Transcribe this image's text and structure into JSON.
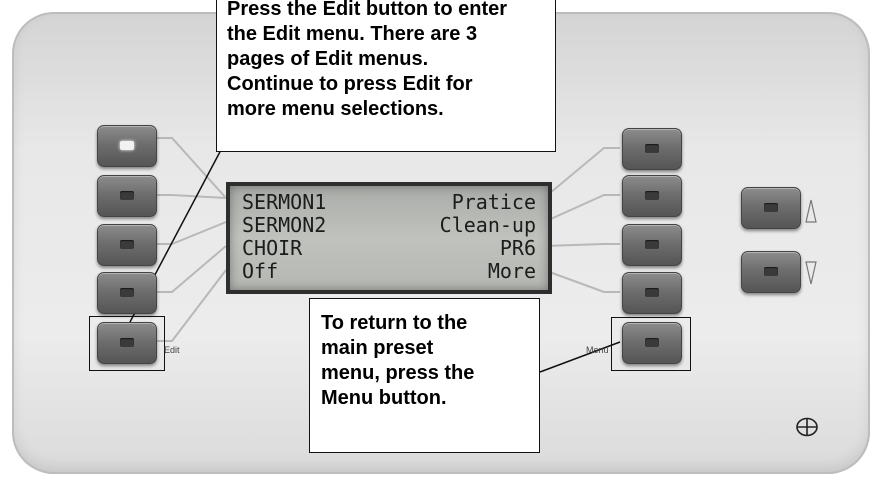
{
  "lcd": {
    "rows": [
      {
        "left": "SERMON1",
        "right": "Pratice"
      },
      {
        "left": "SERMON2",
        "right": "Clean-up"
      },
      {
        "left": "CHOIR",
        "right": "PR6"
      },
      {
        "left": "Off",
        "right": "More"
      }
    ]
  },
  "labels": {
    "edit": "Edit",
    "menu": "Menu"
  },
  "callouts": {
    "edit": [
      "Press the Edit button to enter",
      "the Edit menu. There are 3",
      "pages of Edit menus.",
      "Continue to press Edit for",
      "more menu selections."
    ],
    "menu": [
      "To return to the",
      "main preset",
      "menu, press the",
      "Menu button."
    ]
  },
  "icons": {
    "up": "up-arrow-icon",
    "down": "down-arrow-icon",
    "logo": "circle-cross-logo-icon"
  },
  "colors": {
    "panel": "#e8e8e8",
    "button": "#6e6e6e",
    "lcd": "#bfc2bd"
  }
}
